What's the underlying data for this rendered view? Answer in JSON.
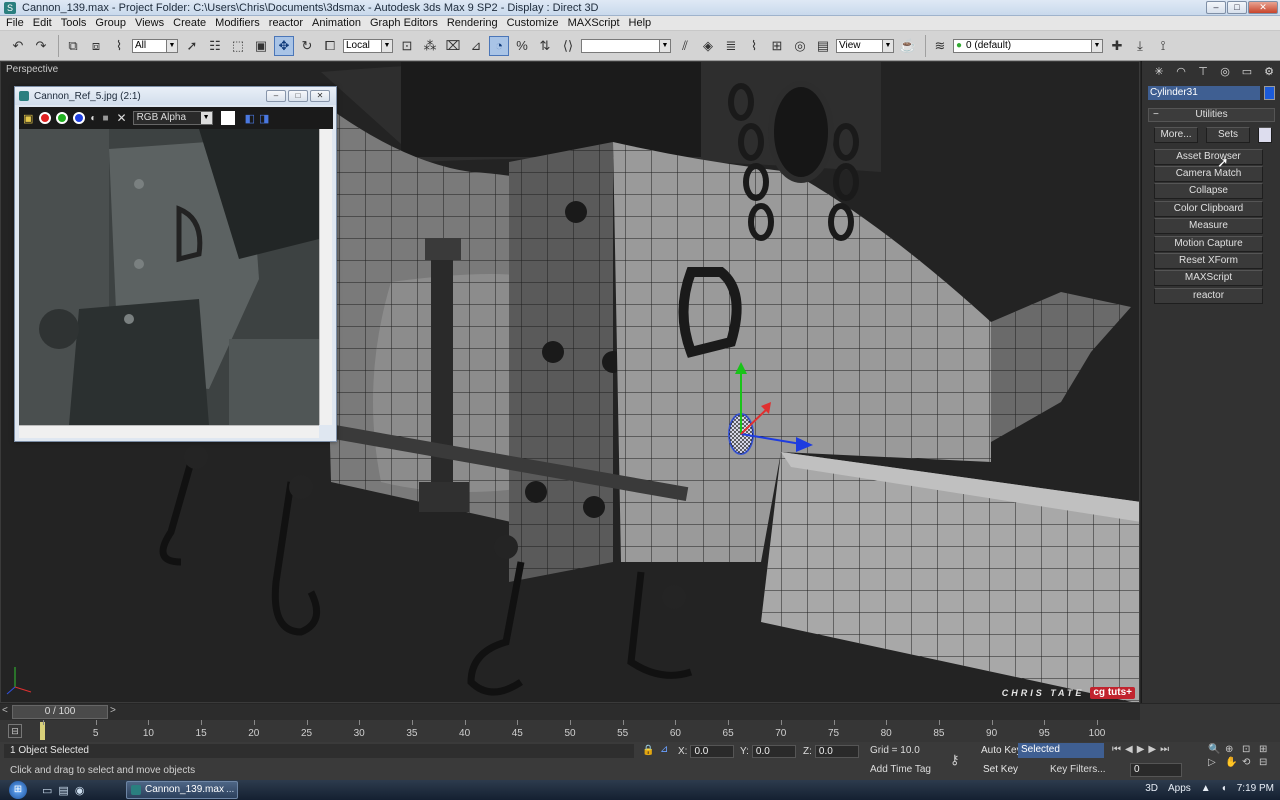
{
  "window": {
    "title": "Cannon_139.max     - Project Folder: C:\\Users\\Chris\\Documents\\3dsmax     - Autodesk 3ds Max 9 SP2     - Display : Direct 3D",
    "minimize": "‒",
    "maximize": "□",
    "close": "✕"
  },
  "menu": [
    "File",
    "Edit",
    "Tools",
    "Group",
    "Views",
    "Create",
    "Modifiers",
    "reactor",
    "Animation",
    "Graph Editors",
    "Rendering",
    "Customize",
    "MAXScript",
    "Help"
  ],
  "toolbar": {
    "selection_filter": "All",
    "ref_coord": "Local",
    "view_set": "View",
    "layer": "0 (default)"
  },
  "viewport": {
    "label": "Perspective",
    "watermark_author": "CHRIS TATE",
    "watermark_brand": "cg tuts+"
  },
  "image_viewer": {
    "title": "Cannon_Ref_5.jpg (2:1)",
    "channel": "RGB Alpha"
  },
  "command_panel": {
    "object_name": "Cylinder31",
    "object_color": "#1c5bd8",
    "rollout_title": "Utilities",
    "more_button": "More...",
    "sets_button": "Sets",
    "utilities": [
      "Asset Browser",
      "Camera Match",
      "Collapse",
      "Color Clipboard",
      "Measure",
      "Motion Capture",
      "Reset XForm",
      "MAXScript",
      "reactor"
    ]
  },
  "timeline": {
    "slider_label": "0 / 100",
    "ticks": [
      "5",
      "10",
      "15",
      "20",
      "25",
      "30",
      "35",
      "40",
      "45",
      "50",
      "55",
      "60",
      "65",
      "70",
      "75",
      "80",
      "85",
      "90",
      "95",
      "100"
    ]
  },
  "status": {
    "selection": "1 Object Selected",
    "prompt": "Click and drag to select and move objects",
    "x_label": "X:",
    "x_value": "0.0",
    "y_label": "Y:",
    "y_value": "0.0",
    "z_label": "Z:",
    "z_value": "0.0",
    "grid": "Grid = 10.0",
    "add_time_tag": "Add Time Tag",
    "auto_key": "Auto Key",
    "set_key": "Set Key",
    "key_mode": "Selected",
    "key_filters": "Key Filters...",
    "frame": "0"
  },
  "taskbar": {
    "task": "Cannon_139.max",
    "task_more": "...",
    "tray_3d": "3D",
    "tray_apps": "Apps",
    "clock": "7:19 PM"
  },
  "colors": {
    "active_tool": "#a9c4e6",
    "name_field": "#3f5f92",
    "brand_red": "#c1232e"
  }
}
